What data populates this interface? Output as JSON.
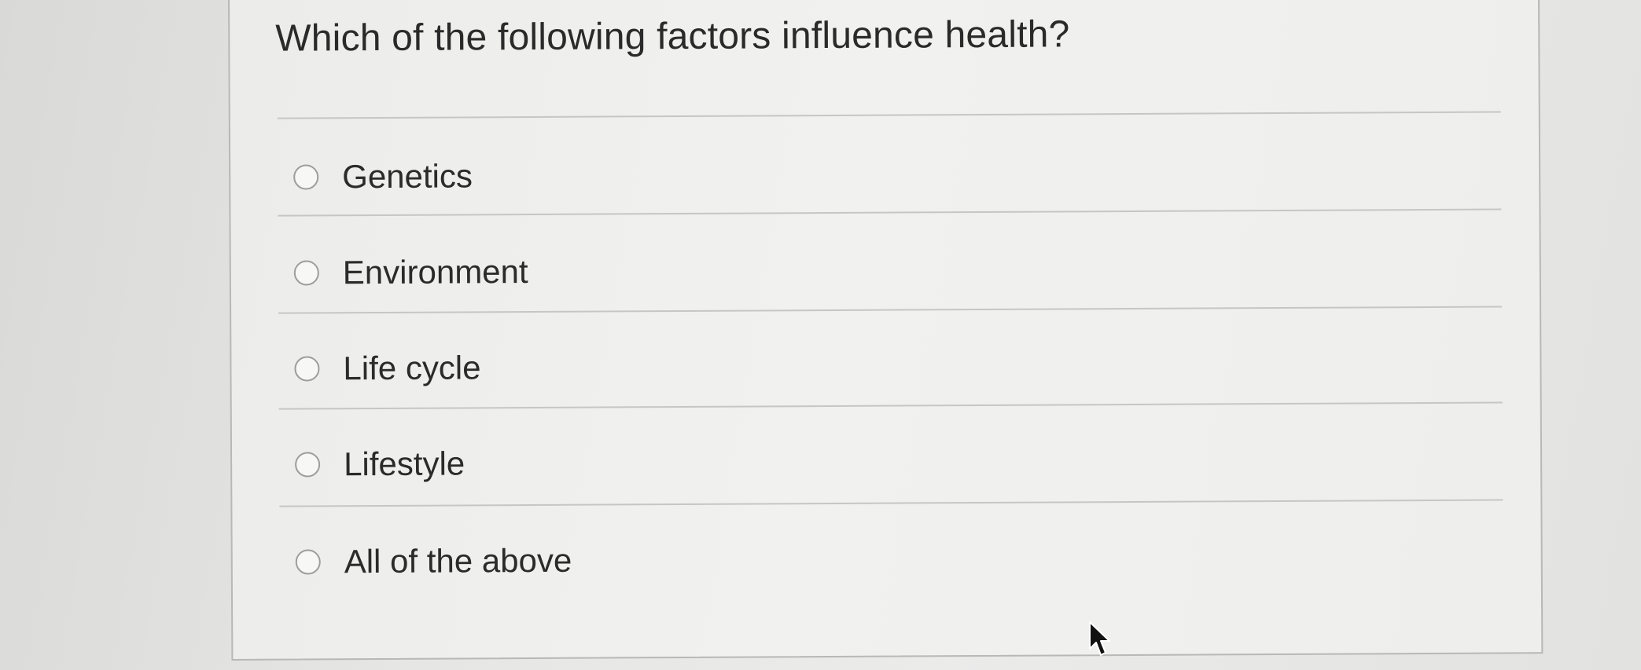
{
  "question": {
    "text": "Which of the following factors influence health?"
  },
  "options": [
    {
      "label": "Genetics",
      "selected": false
    },
    {
      "label": "Environment",
      "selected": false
    },
    {
      "label": "Life cycle",
      "selected": false
    },
    {
      "label": "Lifestyle",
      "selected": false
    },
    {
      "label": "All of the above",
      "selected": false
    }
  ],
  "colors": {
    "background": "#e6e6e4",
    "card": "#efefed",
    "text": "#2a2a2a",
    "radio_border": "#9d9d9b",
    "divider": "#c6c6c4"
  },
  "icons": {
    "cursor": "mouse-pointer-arrow-icon"
  }
}
